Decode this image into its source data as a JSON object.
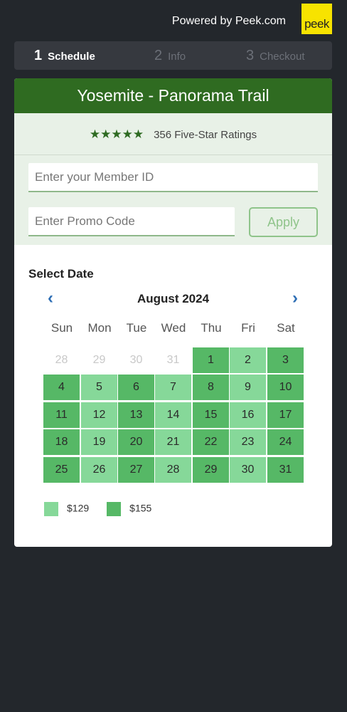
{
  "header": {
    "powered_by": "Powered by Peek.com",
    "logo_text": "peek"
  },
  "steps": [
    {
      "num": "1",
      "label": "Schedule",
      "active": true
    },
    {
      "num": "2",
      "label": "Info",
      "active": false
    },
    {
      "num": "3",
      "label": "Checkout",
      "active": false
    }
  ],
  "tour": {
    "title": "Yosemite - Panorama Trail",
    "stars": "★★★★★",
    "ratings": "356 Five-Star Ratings"
  },
  "form": {
    "member_placeholder": "Enter your Member ID",
    "promo_placeholder": "Enter Promo Code",
    "apply_label": "Apply"
  },
  "calendar": {
    "section_label": "Select Date",
    "month": "August 2024",
    "prev_icon": "‹",
    "next_icon": "›",
    "weekdays": [
      "Sun",
      "Mon",
      "Tue",
      "Wed",
      "Thu",
      "Fri",
      "Sat"
    ],
    "weeks": [
      [
        {
          "d": "28",
          "t": "out"
        },
        {
          "d": "29",
          "t": "out"
        },
        {
          "d": "30",
          "t": "out"
        },
        {
          "d": "31",
          "t": "out"
        },
        {
          "d": "1",
          "t": "dark"
        },
        {
          "d": "2",
          "t": "light"
        },
        {
          "d": "3",
          "t": "dark"
        }
      ],
      [
        {
          "d": "4",
          "t": "dark"
        },
        {
          "d": "5",
          "t": "light"
        },
        {
          "d": "6",
          "t": "dark"
        },
        {
          "d": "7",
          "t": "light"
        },
        {
          "d": "8",
          "t": "dark"
        },
        {
          "d": "9",
          "t": "light"
        },
        {
          "d": "10",
          "t": "dark"
        }
      ],
      [
        {
          "d": "11",
          "t": "dark"
        },
        {
          "d": "12",
          "t": "light"
        },
        {
          "d": "13",
          "t": "dark"
        },
        {
          "d": "14",
          "t": "light"
        },
        {
          "d": "15",
          "t": "dark"
        },
        {
          "d": "16",
          "t": "light"
        },
        {
          "d": "17",
          "t": "dark"
        }
      ],
      [
        {
          "d": "18",
          "t": "dark"
        },
        {
          "d": "19",
          "t": "light"
        },
        {
          "d": "20",
          "t": "dark"
        },
        {
          "d": "21",
          "t": "light"
        },
        {
          "d": "22",
          "t": "dark"
        },
        {
          "d": "23",
          "t": "light"
        },
        {
          "d": "24",
          "t": "dark"
        }
      ],
      [
        {
          "d": "25",
          "t": "dark"
        },
        {
          "d": "26",
          "t": "light"
        },
        {
          "d": "27",
          "t": "dark"
        },
        {
          "d": "28",
          "t": "light"
        },
        {
          "d": "29",
          "t": "dark"
        },
        {
          "d": "30",
          "t": "light"
        },
        {
          "d": "31",
          "t": "dark"
        }
      ]
    ]
  },
  "legend": [
    {
      "label": "$129",
      "color": "#86d899"
    },
    {
      "label": "$155",
      "color": "#56b866"
    }
  ],
  "colors": {
    "brand_green": "#2f6b21",
    "light_price": "#86d899",
    "dark_price": "#56b866",
    "link_blue": "#2f6fb5",
    "logo_yellow": "#f7e300"
  }
}
